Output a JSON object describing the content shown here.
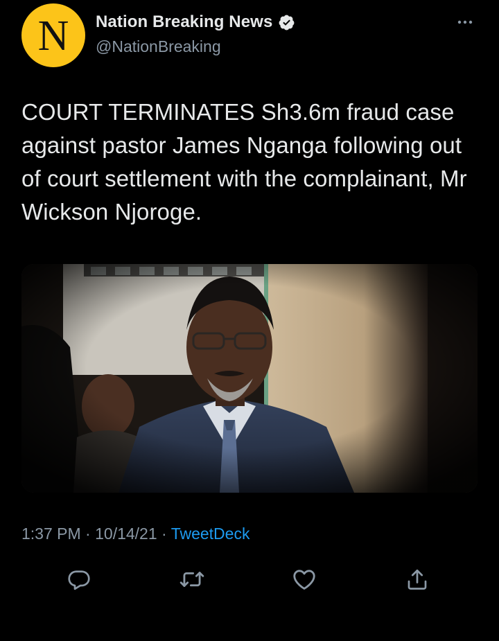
{
  "tweet": {
    "author": {
      "avatar_letter": "N",
      "avatar_color": "#fcc419",
      "display_name": "Nation Breaking News",
      "handle": "@NationBreaking",
      "verified": true
    },
    "text": "COURT TERMINATES Sh3.6m fraud case against pastor James Nganga following out of court settlement with the complainant, Mr Wickson Njoroge.",
    "media": {
      "kind": "photo"
    },
    "meta": {
      "time": "1:37 PM",
      "separator": "·",
      "date": "10/14/21",
      "source": "TweetDeck"
    }
  },
  "actions": {
    "reply_icon": "reply-icon",
    "retweet_icon": "retweet-icon",
    "like_icon": "heart-icon",
    "share_icon": "share-icon"
  },
  "colors": {
    "background": "#000000",
    "text_primary": "#e7e9ea",
    "text_secondary": "#8b98a5",
    "accent": "#1d9bf0"
  }
}
